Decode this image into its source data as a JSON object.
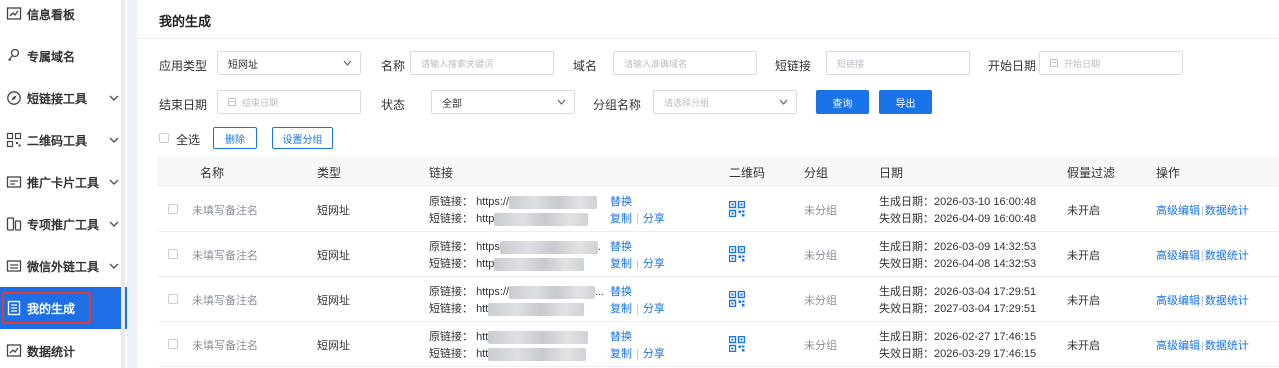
{
  "sidebar": {
    "items": [
      {
        "label": "信息看板",
        "icon": "dashboard-chart-icon",
        "expandable": false
      },
      {
        "label": "专属域名",
        "icon": "link-domain-icon",
        "expandable": false
      },
      {
        "label": "短链接工具",
        "icon": "compass-icon",
        "expandable": true
      },
      {
        "label": "二维码工具",
        "icon": "qr-grid-icon",
        "expandable": true
      },
      {
        "label": "推广卡片工具",
        "icon": "card-icon",
        "expandable": true
      },
      {
        "label": "专项推广工具",
        "icon": "phone-card-icon",
        "expandable": true
      },
      {
        "label": "微信外链工具",
        "icon": "wechat-link-icon",
        "expandable": true
      },
      {
        "label": "我的生成",
        "icon": "document-list-icon",
        "expandable": false,
        "active": true
      },
      {
        "label": "数据统计",
        "icon": "stats-chart-icon",
        "expandable": false
      }
    ]
  },
  "page": {
    "title": "我的生成"
  },
  "filters": {
    "app_type": {
      "label": "应用类型",
      "value": "短网址"
    },
    "name": {
      "label": "名称",
      "placeholder": "请输入搜索关键词"
    },
    "domain": {
      "label": "域名",
      "placeholder": "请输入准确域名"
    },
    "short_link": {
      "label": "短链接",
      "placeholder": "短链接"
    },
    "start_date": {
      "label": "开始日期",
      "placeholder": "开始日期"
    },
    "end_date": {
      "label": "结束日期",
      "placeholder": "结束日期"
    },
    "status": {
      "label": "状态",
      "value": "全部"
    },
    "group": {
      "label": "分组名称",
      "placeholder": "请选择分组"
    },
    "query_button": "查询",
    "export_button": "导出"
  },
  "bulk": {
    "select_all": "全选",
    "delete": "删除",
    "set_group": "设置分组"
  },
  "table": {
    "headers": {
      "name": "名称",
      "type": "类型",
      "link": "链接",
      "qrcode": "二维码",
      "group": "分组",
      "date": "日期",
      "fake_filter": "假量过滤",
      "action": "操作"
    },
    "labels": {
      "orig": "原链接：",
      "short": "短链接：",
      "replace": "替换",
      "copy": "复制",
      "share": "分享",
      "sep": "|",
      "created": "生成日期：",
      "expires": "失效日期：",
      "edit": "高级编辑",
      "stats": "数据统计"
    },
    "rows": [
      {
        "name": "未填写备注名",
        "type": "短网址",
        "orig_prefix": "https://",
        "orig_tail": "",
        "short_prefix": "http",
        "group": "未分组",
        "created": "2026-03-10 16:00:48",
        "expires": "2026-04-09 16:00:48",
        "fake_filter": "未开启"
      },
      {
        "name": "未填写备注名",
        "type": "短网址",
        "orig_prefix": "https",
        "orig_tail": ".",
        "short_prefix": "http",
        "group": "未分组",
        "created": "2026-03-09 14:32:53",
        "expires": "2026-04-08 14:32:53",
        "fake_filter": "未开启"
      },
      {
        "name": "未填写备注名",
        "type": "短网址",
        "orig_prefix": "https://",
        "orig_tail": "...",
        "short_prefix": "htt",
        "group": "未分组",
        "created": "2026-03-04 17:29:51",
        "expires": "2027-03-04 17:29:51",
        "fake_filter": "未开启"
      },
      {
        "name": "未填写备注名",
        "type": "短网址",
        "orig_prefix": "htt",
        "orig_tail": "",
        "short_prefix": "htt",
        "group": "未分组",
        "created": "2026-02-27 17:46:15",
        "expires": "2026-03-29 17:46:15",
        "fake_filter": "未开启"
      }
    ]
  },
  "colors": {
    "accent": "#1a73e8",
    "active_bg": "#1e6fe6",
    "highlight": "#e53935"
  }
}
